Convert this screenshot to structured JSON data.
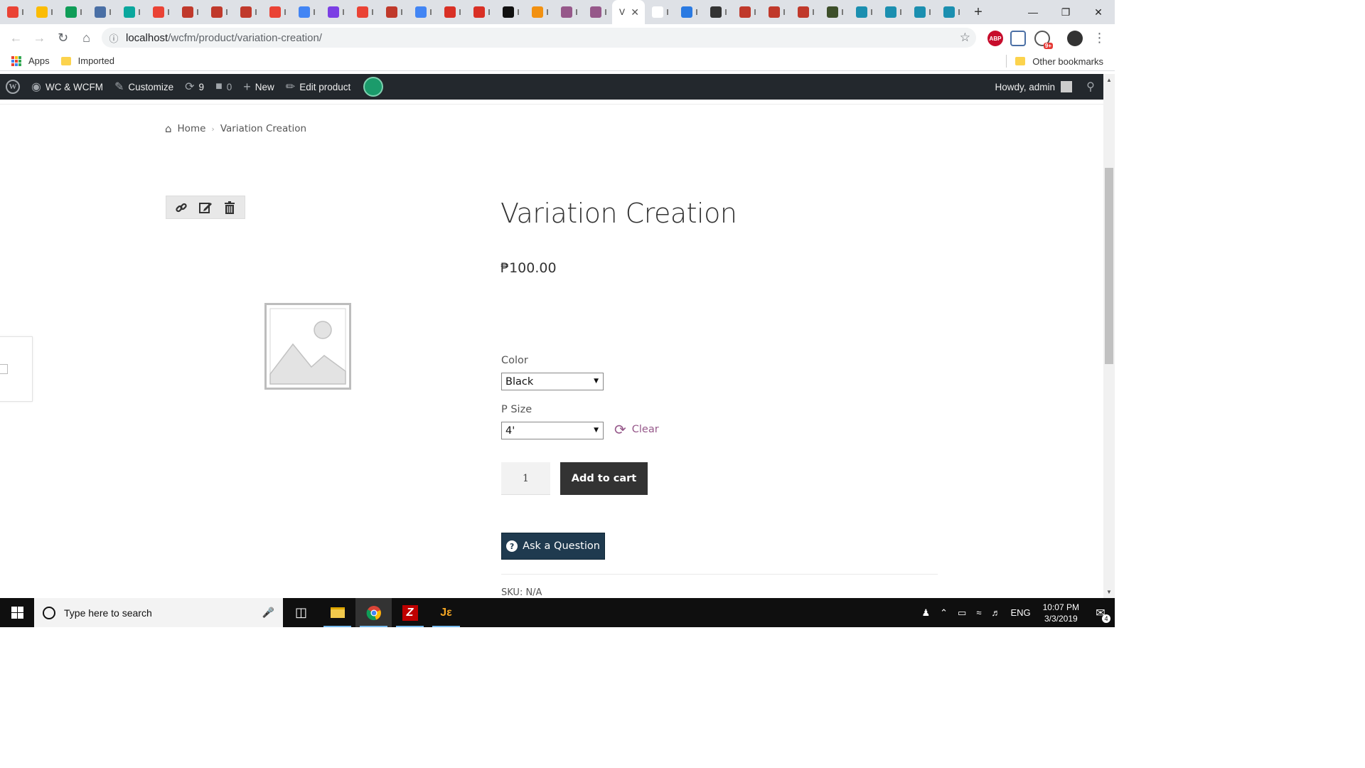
{
  "browser": {
    "tabs": [
      {
        "icon": "gmail-icon",
        "color": "#ea4335"
      },
      {
        "icon": "drive-icon",
        "color": "#fbbc04"
      },
      {
        "icon": "sheets-icon",
        "color": "#0f9d58"
      },
      {
        "icon": "inbox-icon",
        "color": "#4a6fa5"
      },
      {
        "icon": "classroom-icon",
        "color": "#0aa79d"
      },
      {
        "icon": "gmail-icon",
        "color": "#ea4335"
      },
      {
        "icon": "leaf-icon",
        "color": "#c0392b"
      },
      {
        "icon": "leaf-icon",
        "color": "#c0392b"
      },
      {
        "icon": "leaf-icon",
        "color": "#c0392b"
      },
      {
        "icon": "gmail-icon",
        "color": "#ea4335"
      },
      {
        "icon": "docs-icon",
        "color": "#4285f4"
      },
      {
        "icon": "chrome-web-icon",
        "color": "#7b3fe4"
      },
      {
        "icon": "gmail-icon",
        "color": "#ea4335"
      },
      {
        "icon": "leaf-icon",
        "color": "#c0392b"
      },
      {
        "icon": "docs-icon",
        "color": "#4285f4"
      },
      {
        "icon": "acrobat-icon",
        "color": "#d93025"
      },
      {
        "icon": "acrobat-icon",
        "color": "#d93025"
      },
      {
        "icon": "ide-icon",
        "color": "#111111"
      },
      {
        "icon": "pma-icon",
        "color": "#f29111"
      },
      {
        "icon": "woo-icon",
        "color": "#96588a"
      },
      {
        "icon": "woo-icon",
        "color": "#96588a"
      },
      {
        "icon": "page-icon",
        "color": "#ffffff"
      },
      {
        "icon": "ibb-icon",
        "color": "#2a7ae2"
      },
      {
        "icon": "film-icon",
        "color": "#333333"
      },
      {
        "icon": "leaf-icon",
        "color": "#c0392b"
      },
      {
        "icon": "leaf-icon",
        "color": "#c0392b"
      },
      {
        "icon": "leaf-icon",
        "color": "#c0392b"
      },
      {
        "icon": "person-icon",
        "color": "#3d4f2a"
      },
      {
        "icon": "globe-icon",
        "color": "#1b8fb0"
      },
      {
        "icon": "globe-icon",
        "color": "#1b8fb0"
      },
      {
        "icon": "globe-icon",
        "color": "#1b8fb0"
      },
      {
        "icon": "globe-icon",
        "color": "#1b8fb0"
      }
    ],
    "active_tab_label": "V",
    "new_tab": "+",
    "url_host": "localhost",
    "url_path": "/wcfm/product/variation-creation/",
    "extensions": [
      {
        "label": "ABP",
        "color": "#c70d2c"
      },
      {
        "label": "",
        "color": "#4a6fa5"
      },
      {
        "label": "9+",
        "color": "#555555"
      },
      {
        "label": "",
        "color": "#333333"
      }
    ],
    "bookmarks": {
      "apps": "Apps",
      "imported": "Imported",
      "other": "Other bookmarks"
    }
  },
  "adminbar": {
    "site_name": "WC & WCFM",
    "customize": "Customize",
    "updates_count": "9",
    "comments_count": "0",
    "new": "New",
    "edit_product": "Edit product",
    "howdy": "Howdy, admin"
  },
  "breadcrumb": {
    "home": "Home",
    "current": "Variation Creation"
  },
  "product": {
    "title": "Variation Creation",
    "price": "₱100.00",
    "color_label": "Color",
    "color_value": "Black",
    "size_label": "P Size",
    "size_value": "4'",
    "clear": "Clear",
    "quantity": "1",
    "add_to_cart": "Add to cart",
    "ask_question": "Ask a Question",
    "sku": "SKU: N/A"
  },
  "taskbar": {
    "search_placeholder": "Type here to search",
    "language": "ENG",
    "time": "10:07 PM",
    "date": "3/3/2019",
    "notifications": "4"
  }
}
